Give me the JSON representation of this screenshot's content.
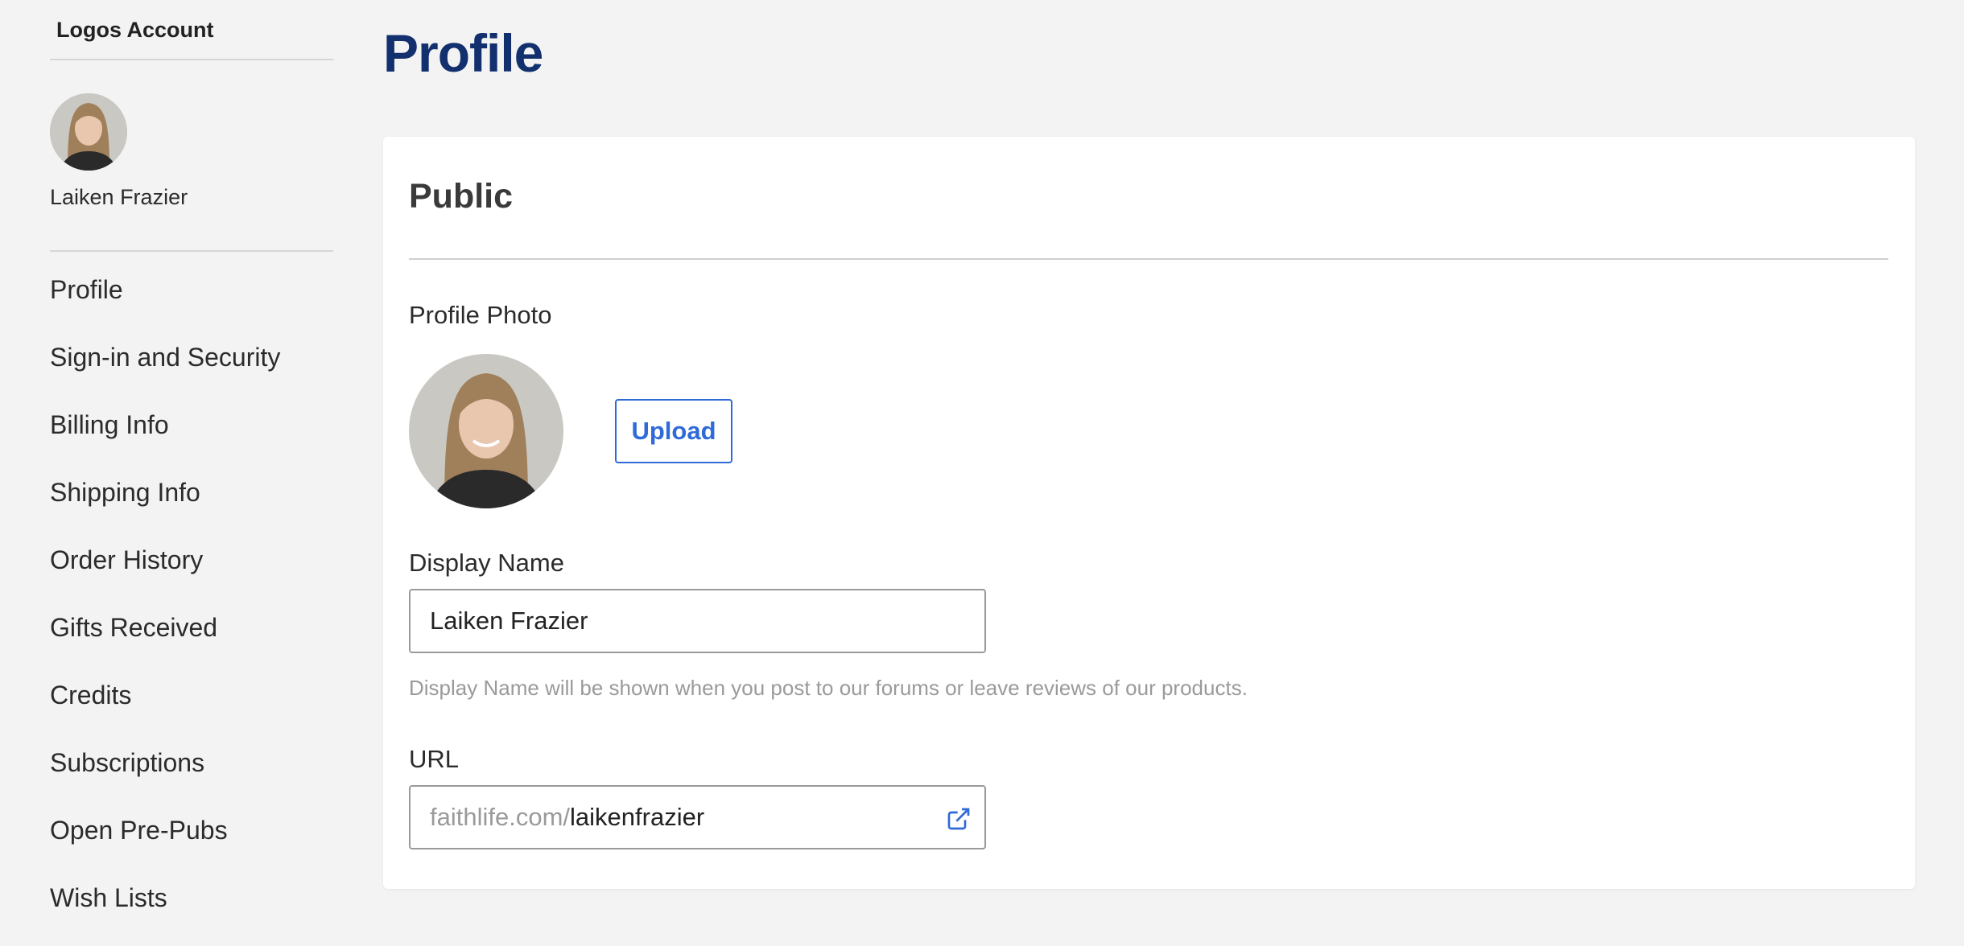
{
  "sidebar": {
    "title": "Logos Account",
    "username": "Laiken Frazier",
    "items": [
      {
        "label": "Profile"
      },
      {
        "label": "Sign-in and Security"
      },
      {
        "label": "Billing Info"
      },
      {
        "label": "Shipping Info"
      },
      {
        "label": "Order History"
      },
      {
        "label": "Gifts Received"
      },
      {
        "label": "Credits"
      },
      {
        "label": "Subscriptions"
      },
      {
        "label": "Open Pre-Pubs"
      },
      {
        "label": "Wish Lists"
      }
    ]
  },
  "main": {
    "title": "Profile",
    "section_title": "Public",
    "profile_photo_label": "Profile Photo",
    "upload_label": "Upload",
    "display_name_label": "Display Name",
    "display_name_value": "Laiken Frazier",
    "display_name_help": "Display Name will be shown when you post to our forums or leave reviews of our products.",
    "url_label": "URL",
    "url_prefix": "faithlife.com/",
    "url_value": "laikenfrazier"
  },
  "colors": {
    "title": "#12306e",
    "accent": "#2f6ad8",
    "background": "#f3f3f3"
  },
  "icons": {
    "avatar": "avatar-photo",
    "external_link": "external-link-icon"
  }
}
